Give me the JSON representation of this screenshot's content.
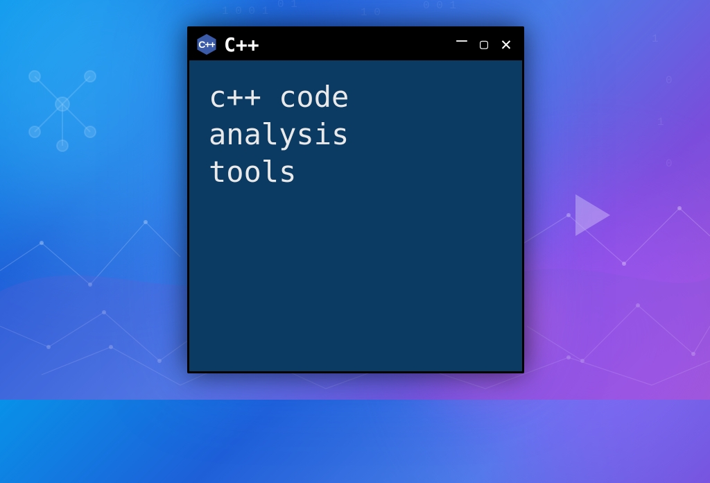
{
  "window": {
    "title": "C++",
    "icon_label": "C++",
    "controls": {
      "minimize": "–",
      "maximize": "▢",
      "close": "✕"
    },
    "body_text": "c++ code\nanalysis\ntools"
  }
}
